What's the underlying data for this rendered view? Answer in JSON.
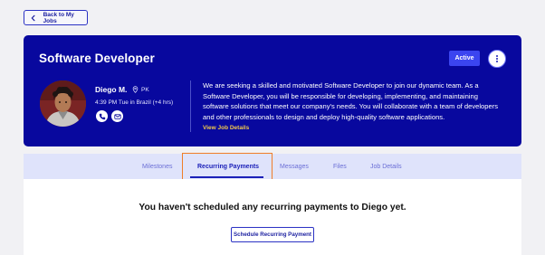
{
  "nav": {
    "back_label": "Back to My Jobs"
  },
  "job": {
    "title": "Software Developer",
    "status": "Active",
    "description": "We are seeking a skilled and motivated Software Developer to join our dynamic team. As a Software Developer, you will be responsible for developing, implementing, and maintaining software solutions that meet our company's needs. You will collaborate with a team of developers and other professionals to design and deploy high-quality software applications.",
    "view_details_label": "View Job Details"
  },
  "freelancer": {
    "name": "Diego M.",
    "country": "PK",
    "local_time": "4:39 PM Tue in Brazil (+4 hrs)"
  },
  "tabs": [
    {
      "label": "Milestones",
      "active": false
    },
    {
      "label": "Recurring Payments",
      "active": true
    },
    {
      "label": "Messages",
      "active": false
    },
    {
      "label": "Files",
      "active": false
    },
    {
      "label": "Job Details",
      "active": false
    }
  ],
  "recurring": {
    "empty_message": "You haven't scheduled any recurring payments to Diego yet.",
    "schedule_label": "Schedule Recurring Payment"
  },
  "icons": [
    "chevron-left-icon",
    "more-vertical-icon",
    "map-pin-icon",
    "phone-icon",
    "mail-icon"
  ],
  "colors": {
    "banner": "#08089e",
    "accent": "#3b45f0",
    "highlight": "#f07d28",
    "link": "#f2c94c",
    "tabs_bg": "#dfe3fb"
  }
}
